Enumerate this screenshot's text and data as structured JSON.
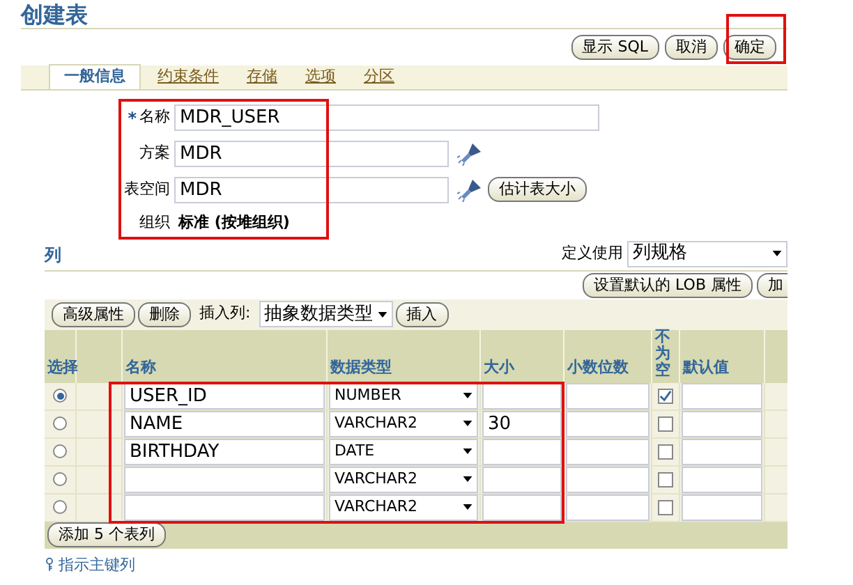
{
  "title": "创建表",
  "top_buttons": [
    "显示 SQL",
    "取消",
    "确定"
  ],
  "tabs": [
    {
      "label": "一般信息",
      "selected": true
    },
    {
      "label": "约束条件",
      "selected": false
    },
    {
      "label": "存储",
      "selected": false
    },
    {
      "label": "选项",
      "selected": false
    },
    {
      "label": "分区",
      "selected": false
    }
  ],
  "form": {
    "name_label": "名称",
    "required_mark": "*",
    "name_value": "MDR_USER",
    "schema_label": "方案",
    "schema_value": "MDR",
    "tablespace_label": "表空间",
    "tablespace_value": "MDR",
    "estimate_button": "估计表大小",
    "organization_label": "组织",
    "organization_value": "标准 (按堆组织)"
  },
  "columns_section": {
    "heading": "列",
    "define_label": "定义使用",
    "define_value": "列规格",
    "lob_button": "设置默认的 LOB 属性",
    "cut_button": "加"
  },
  "toolbar": {
    "advanced_button": "高级属性",
    "delete_button": "删除",
    "insert_label": "插入列:",
    "insert_type": "抽象数据类型",
    "insert_button": "插入"
  },
  "table": {
    "headers": [
      "选择",
      "名称",
      "数据类型",
      "大小",
      "小数位数",
      "不为空",
      "默认值"
    ],
    "rows": [
      {
        "selected": true,
        "name": "USER_ID",
        "type": "NUMBER",
        "size": "",
        "not_null": true
      },
      {
        "selected": false,
        "name": "NAME",
        "type": "VARCHAR2",
        "size": "30",
        "not_null": false
      },
      {
        "selected": false,
        "name": "BIRTHDAY",
        "type": "DATE",
        "size": "",
        "not_null": false
      },
      {
        "selected": false,
        "name": "",
        "type": "VARCHAR2",
        "size": "",
        "not_null": false
      },
      {
        "selected": false,
        "name": "",
        "type": "VARCHAR2",
        "size": "",
        "not_null": false
      }
    ]
  },
  "add_button": "添加 5 个表列",
  "primary_key_link": "指示主键列"
}
